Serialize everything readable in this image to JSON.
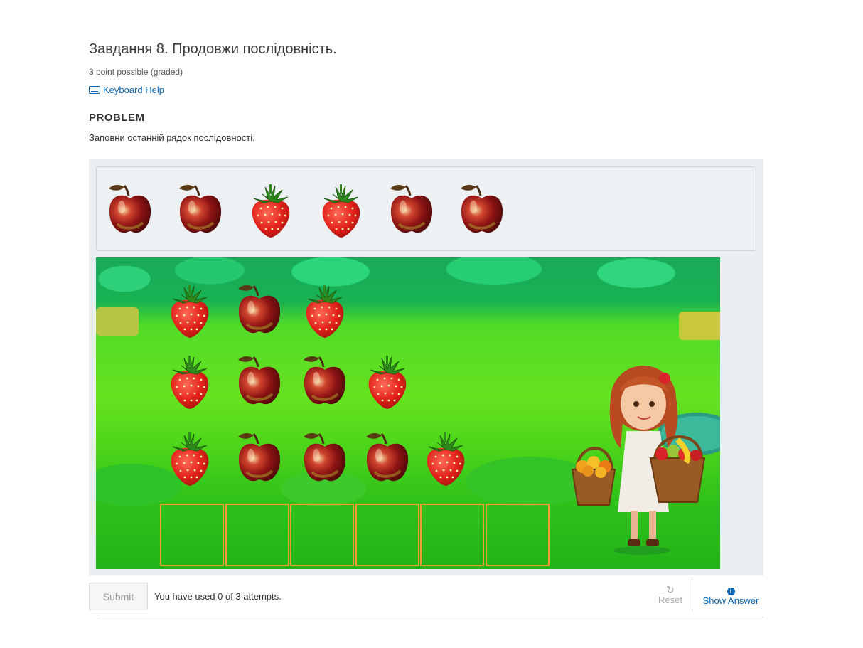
{
  "header": {
    "title": "Завдання 8. Продовжи послідовність.",
    "points": "3 point possible (graded)",
    "keyboard_help": "Keyboard Help",
    "section": "PROBLEM",
    "instruction": "Заповни останній рядок послідовності."
  },
  "tray": {
    "items": [
      "apple",
      "apple",
      "strawberry",
      "strawberry",
      "apple",
      "apple"
    ]
  },
  "scene": {
    "rows": [
      [
        "strawberry",
        "apple",
        "strawberry"
      ],
      [
        "strawberry",
        "apple",
        "apple",
        "strawberry"
      ],
      [
        "strawberry",
        "apple",
        "apple",
        "apple",
        "strawberry"
      ]
    ],
    "empty_slots": 6,
    "character": "girl-with-fruit-baskets"
  },
  "footer": {
    "submit_label": "Submit",
    "attempts_text": "You have used 0 of 3 attempts.",
    "reset_label": "Reset",
    "show_answer_label": "Show Answer"
  },
  "colors": {
    "link": "#0a67b8",
    "slot_border": "#f39a33",
    "grass": "#52dc27"
  }
}
